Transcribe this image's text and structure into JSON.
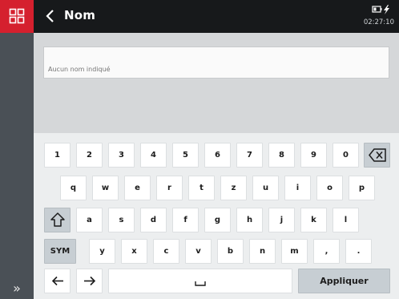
{
  "header": {
    "title": "Nom",
    "time": "02:27:10"
  },
  "field": {
    "placeholder": "Aucun nom indiqué"
  },
  "keyboard": {
    "row1": [
      "1",
      "2",
      "3",
      "4",
      "5",
      "6",
      "7",
      "8",
      "9",
      "0"
    ],
    "row2": [
      "q",
      "w",
      "e",
      "r",
      "t",
      "z",
      "u",
      "i",
      "o",
      "p"
    ],
    "row3": [
      "a",
      "s",
      "d",
      "f",
      "g",
      "h",
      "j",
      "k",
      "l"
    ],
    "row4": [
      "y",
      "x",
      "c",
      "v",
      "b",
      "n",
      "m",
      ",",
      "."
    ],
    "sym_label": "SYM",
    "apply_label": "Appliquer"
  },
  "icons": {
    "menu": "grid-icon",
    "back": "chevron-left-icon",
    "battery": "battery-icon",
    "charging": "lightning-icon",
    "expand": "double-chevron-right-icon",
    "backspace": "backspace-icon",
    "shift": "shift-icon",
    "left": "arrow-left-icon",
    "right": "arrow-right-icon",
    "space": "space-icon"
  },
  "colors": {
    "brand_red": "#d5202e",
    "header_bg": "#17191b",
    "rail_bg": "#4a5056"
  }
}
